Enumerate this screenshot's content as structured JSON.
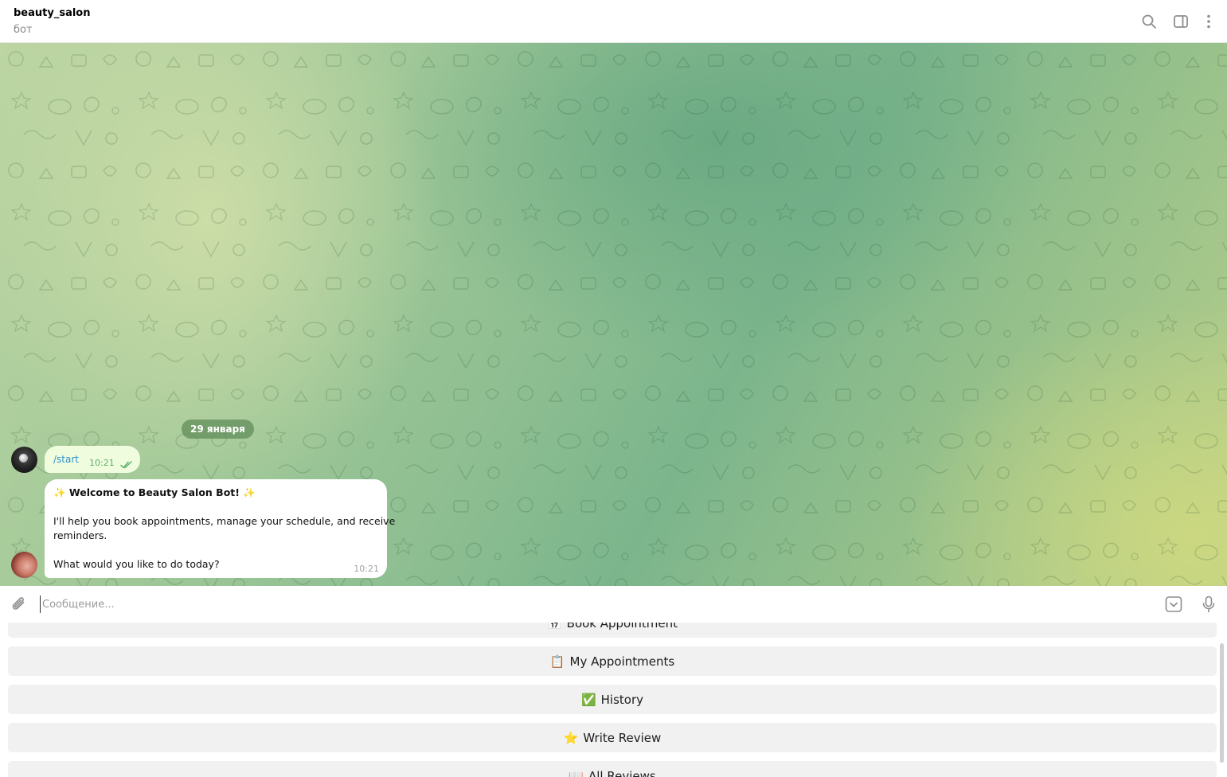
{
  "header": {
    "title": "beauty_salon",
    "subtitle": "бот",
    "icons": [
      "search-icon",
      "sidebar-toggle-icon",
      "more-vertical-icon"
    ]
  },
  "chat": {
    "date_label": "29 января",
    "outgoing": {
      "text": "/start",
      "time": "10:21",
      "status_icon": "double-check-icon"
    },
    "incoming": {
      "line1": "✨ Welcome to Beauty Salon Bot! ✨",
      "line2": "I'll help you book appointments, manage your schedule, and receive",
      "line3": "reminders.",
      "line4": "What would you like to do today?",
      "time": "10:21"
    }
  },
  "composer": {
    "placeholder": "Сообщение...",
    "value": "",
    "icons": [
      "paperclip-icon",
      "keyboard-toggle-icon",
      "microphone-icon"
    ]
  },
  "keyboard": {
    "buttons": [
      {
        "emoji": "📅",
        "label": "Book Appointment"
      },
      {
        "emoji": "📋",
        "label": "My Appointments"
      },
      {
        "emoji": "✅",
        "label": "History"
      },
      {
        "emoji": "⭐",
        "label": "Write Review"
      },
      {
        "emoji": "📖",
        "label": "All Reviews"
      }
    ]
  },
  "colors": {
    "outgoing_bubble": "#effdde",
    "incoming_bubble": "#ffffff",
    "link": "#2f8fcc",
    "check": "#5fae6a",
    "keyboard_button": "#f1f1f1"
  }
}
